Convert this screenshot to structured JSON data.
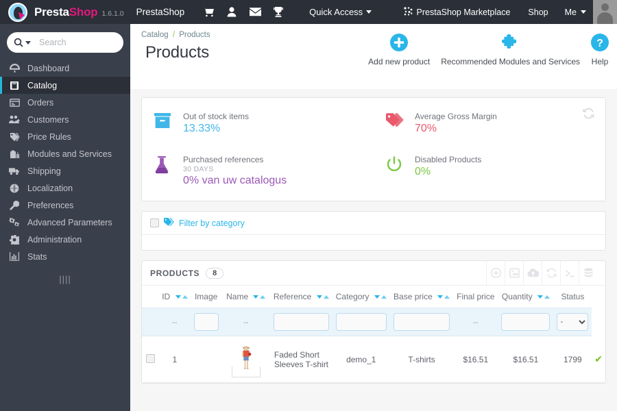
{
  "header": {
    "brand_first": "Presta",
    "brand_second": "Shop",
    "version": "1.6.1.0",
    "shop_name": "PrestaShop",
    "icons": [
      "cart-icon",
      "user-icon",
      "envelope-icon",
      "trophy-icon"
    ],
    "quick_access": "Quick Access",
    "marketplace": "PrestaShop Marketplace",
    "shop_link": "Shop",
    "me_link": "Me"
  },
  "sidebar": {
    "search_placeholder": "Search",
    "items": [
      {
        "label": "Dashboard",
        "icon": "dashboard-icon",
        "active": false
      },
      {
        "label": "Catalog",
        "icon": "catalog-icon",
        "active": true
      },
      {
        "label": "Orders",
        "icon": "orders-icon",
        "active": false
      },
      {
        "label": "Customers",
        "icon": "customers-icon",
        "active": false
      },
      {
        "label": "Price Rules",
        "icon": "price-rules-icon",
        "active": false
      },
      {
        "label": "Modules and Services",
        "icon": "modules-icon",
        "active": false
      },
      {
        "label": "Shipping",
        "icon": "shipping-icon",
        "active": false
      },
      {
        "label": "Localization",
        "icon": "localization-icon",
        "active": false
      },
      {
        "label": "Preferences",
        "icon": "preferences-icon",
        "active": false
      },
      {
        "label": "Advanced Parameters",
        "icon": "advanced-parameters-icon",
        "active": false
      },
      {
        "label": "Administration",
        "icon": "administration-icon",
        "active": false
      },
      {
        "label": "Stats",
        "icon": "stats-icon",
        "active": false
      }
    ],
    "collapse_glyph": "||||"
  },
  "page": {
    "breadcrumb_parent": "Catalog",
    "breadcrumb_sep": "/",
    "breadcrumb_current": "Products",
    "title": "Products",
    "actions": [
      {
        "label": "Add new product",
        "icon": "plus-circle-icon"
      },
      {
        "label": "Recommended Modules and Services",
        "icon": "puzzle-icon"
      },
      {
        "label": "Help",
        "icon": "question-circle-icon"
      }
    ]
  },
  "kpis": [
    {
      "label": "Out of stock items",
      "sub": "",
      "value": "13.33%",
      "color": "#41b7e8",
      "icon": "box-icon"
    },
    {
      "label": "Average Gross Margin",
      "sub": "",
      "value": "70%",
      "color": "#e8596b",
      "icon": "tags-icon"
    },
    {
      "label": "Purchased references",
      "sub": "30 DAYS",
      "value": "0% van uw catalogus",
      "color": "#9b59b6",
      "icon": "flask-icon"
    },
    {
      "label": "Disabled Products",
      "sub": "",
      "value": "0%",
      "color": "#7ac943",
      "icon": "power-icon"
    }
  ],
  "kpi_refresh_icon": "refresh-icon",
  "filter": {
    "label": "Filter by category",
    "icon": "tag-icon"
  },
  "products_panel": {
    "title": "PRODUCTS",
    "count": "8",
    "tools": [
      "plus-circle-icon",
      "export-icon",
      "import-cloud-icon",
      "refresh-icon",
      "sql-terminal-icon",
      "database-icon"
    ],
    "columns": [
      {
        "label": "",
        "sortable": false
      },
      {
        "label": "ID",
        "sortable": true
      },
      {
        "label": "Image",
        "sortable": false
      },
      {
        "label": "Name",
        "sortable": true
      },
      {
        "label": "Reference",
        "sortable": true
      },
      {
        "label": "Category",
        "sortable": true
      },
      {
        "label": "Base price",
        "sortable": true
      },
      {
        "label": "Final price",
        "sortable": false
      },
      {
        "label": "Quantity",
        "sortable": true
      },
      {
        "label": "Status",
        "sortable": false
      }
    ],
    "filter_row": {
      "id_dash": "--",
      "id_value": "",
      "image_dash": "--",
      "name_value": "",
      "reference_value": "",
      "category_value": "",
      "base_price_value": "",
      "final_price_dash": "--",
      "quantity_value": "",
      "status_selected": "-"
    },
    "rows": [
      {
        "selected": false,
        "id": "1",
        "image": "faded-short-sleeves-tshirt-thumbnail",
        "name": "Faded Short Sleeves T-shirt",
        "reference": "demo_1",
        "category": "T-shirts",
        "base_price": "$16.51",
        "final_price": "$16.51",
        "quantity": "1799",
        "status": "enabled",
        "status_glyph": "✔"
      }
    ]
  },
  "colors": {
    "accent_blue": "#29b6e8",
    "header_dark": "#2b2f38",
    "sidebar_dark": "#3a3f4c",
    "active_green": "#72c41c"
  }
}
